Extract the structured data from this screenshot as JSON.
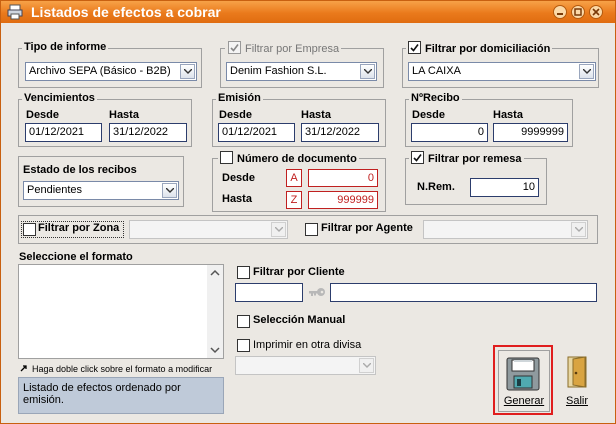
{
  "window": {
    "title": "Listados de efectos a cobrar"
  },
  "tipo_informe": {
    "label": "Tipo de informe",
    "value": "Archivo SEPA (Básico - B2B)"
  },
  "empresa": {
    "label": "Filtrar por Empresa",
    "checked": true,
    "value": "Denim Fashion S.L."
  },
  "domiciliacion": {
    "label": "Filtrar por domiciliación",
    "checked": true,
    "value": "LA CAIXA"
  },
  "vencimientos": {
    "title": "Vencimientos",
    "desde_label": "Desde",
    "hasta_label": "Hasta",
    "desde": "01/12/2021",
    "hasta": "31/12/2022"
  },
  "emision": {
    "title": "Emisión",
    "desde_label": "Desde",
    "hasta_label": "Hasta",
    "desde": "01/12/2021",
    "hasta": "31/12/2022"
  },
  "nrecibo": {
    "title": "NºRecibo",
    "desde_label": "Desde",
    "hasta_label": "Hasta",
    "desde": "0",
    "hasta": "9999999"
  },
  "estado": {
    "label": "Estado de los recibos",
    "value": "Pendientes"
  },
  "numero_documento": {
    "label": "Número de documento",
    "checked": false,
    "desde_label": "Desde",
    "hasta_label": "Hasta",
    "desde_letter": "A",
    "hasta_letter": "Z",
    "desde": "0",
    "hasta": "999999"
  },
  "remesa": {
    "label": "Filtrar por remesa",
    "checked": true,
    "nrem_label": "N.Rem.",
    "nrem": "10"
  },
  "zona": {
    "label": "Filtrar por Zona",
    "checked": false
  },
  "agente": {
    "label": "Filtrar por Agente",
    "checked": false
  },
  "formato": {
    "label": "Seleccione el formato",
    "hint": "Haga doble click sobre el formato a modificar",
    "description": "Listado de efectos ordenado por emisión."
  },
  "cliente": {
    "label": "Filtrar por Cliente",
    "checked": false
  },
  "manual": {
    "label": "Selección Manual",
    "checked": false
  },
  "divisa": {
    "label": "Imprimir en otra divisa",
    "checked": false
  },
  "buttons": {
    "generar": "Generar",
    "salir": "Salir"
  },
  "colors": {
    "title_bar": "#ea7a1c",
    "highlight": "#e01e1e",
    "description_bg": "#bfcad9"
  }
}
